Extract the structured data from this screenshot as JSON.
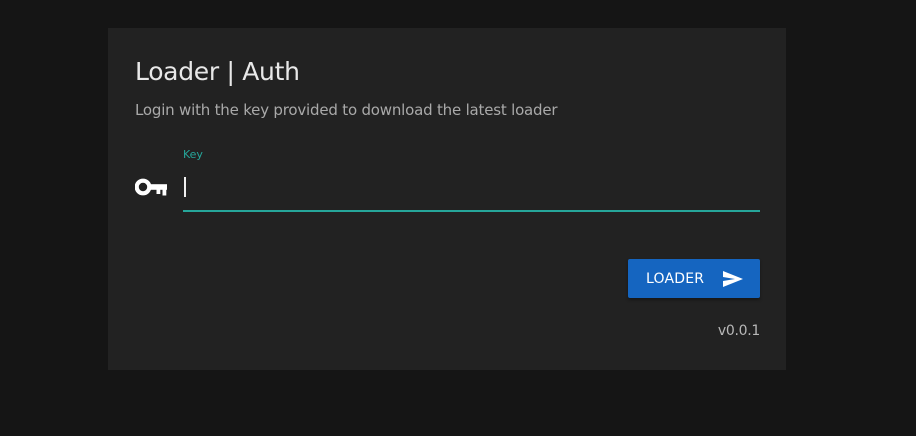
{
  "card": {
    "title": "Loader | Auth",
    "subtitle": "Login with the key provided to download the latest loader"
  },
  "key_field": {
    "label": "Key",
    "value": "",
    "icon": "key-icon"
  },
  "actions": {
    "loader_label": "LOADER",
    "loader_icon": "send-icon"
  },
  "version": "v0.0.1",
  "colors": {
    "background": "#151515",
    "card": "#222222",
    "accent": "#26a69a",
    "button": "#1565c0"
  }
}
